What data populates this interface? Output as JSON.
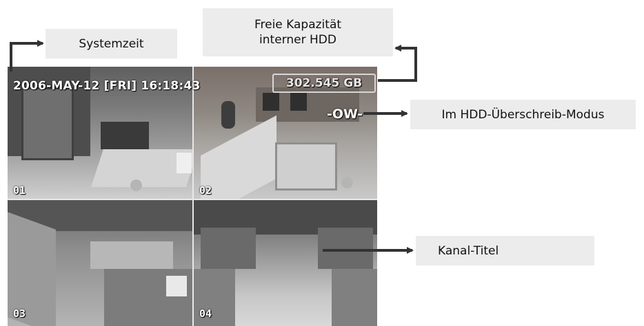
{
  "labels": {
    "systemzeit": "Systemzeit",
    "freie_line1": "Freie Kapazität",
    "freie_line2": "interner HDD",
    "hdd_modus": "Im HDD-Überschreib-Modus",
    "kanal_titel": "Kanal-Titel"
  },
  "osd": {
    "datetime": "2006-MAY-12 [FRI] 16:18:43",
    "hdd_free": "302.545 GB",
    "overwrite": "-OW-",
    "channels": [
      "01",
      "02",
      "03",
      "04"
    ]
  },
  "colors": {
    "label_bg": "#ececec",
    "arrow": "#333333",
    "osd_text": "#ffffff"
  }
}
